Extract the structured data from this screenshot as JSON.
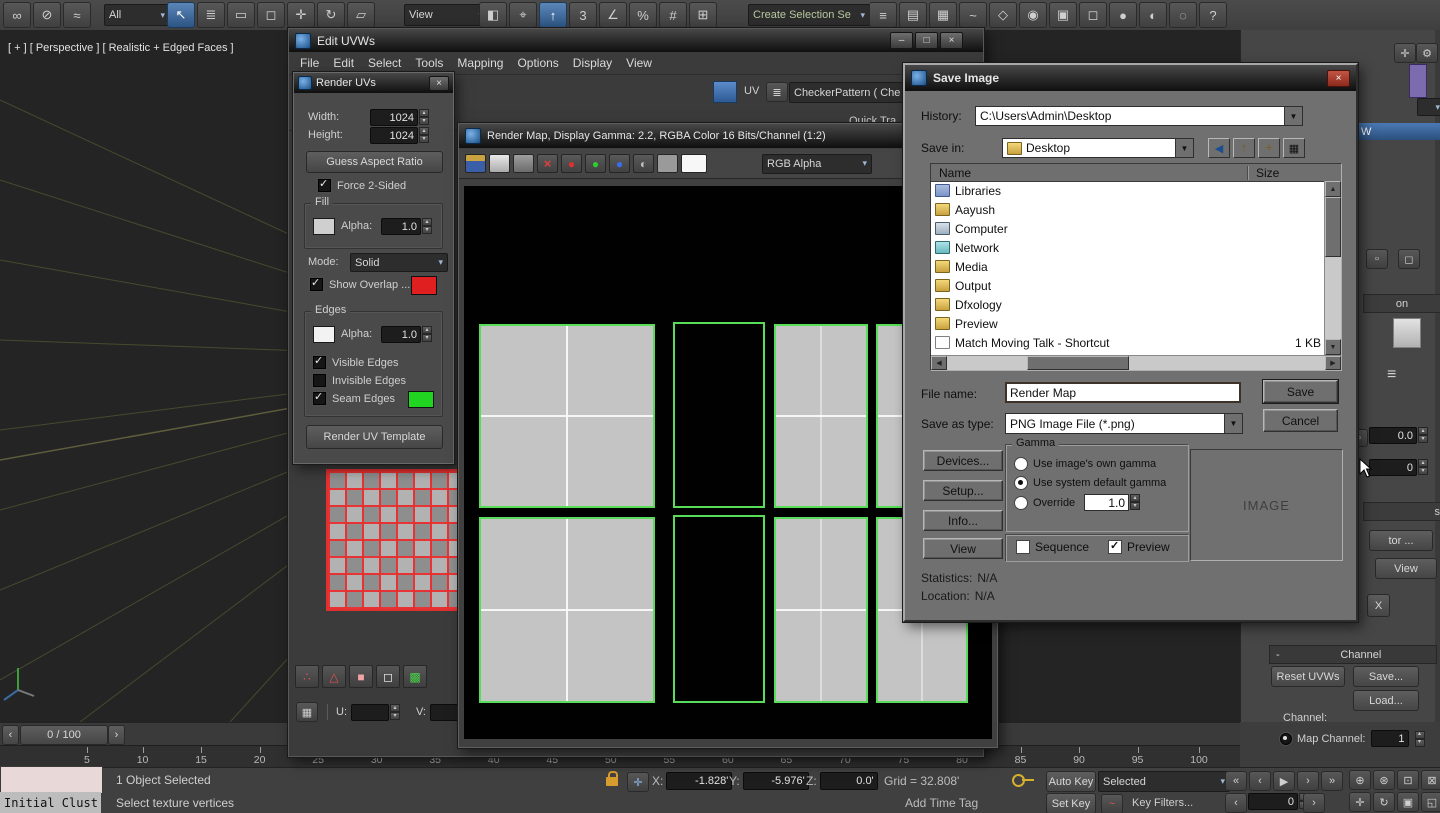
{
  "glyphs": {
    "close": "×",
    "minimize": "–",
    "maximize": "□"
  },
  "viewport": {
    "label": "[ + ] [ Perspective ] [ Realistic + Edged Faces ]"
  },
  "main_toolbar": {
    "all_dropdown": "All",
    "view_dropdown": "View",
    "create_selection_dropdown": "Create Selection Se",
    "icons_g1": [
      {
        "name": "select-and-link-icon",
        "glyph": "∞"
      },
      {
        "name": "unlink-selection-icon",
        "glyph": "⊘"
      },
      {
        "name": "bind-to-space-warp-icon",
        "glyph": "≈"
      }
    ],
    "icons_g2": [
      {
        "name": "select-object-icon",
        "glyph": "↖",
        "cls": "active"
      },
      {
        "name": "select-by-name-icon",
        "glyph": "≣"
      },
      {
        "name": "rectangular-selection-region-icon",
        "glyph": "▭"
      },
      {
        "name": "window-crossing-toggle-icon",
        "glyph": "◻"
      },
      {
        "name": "select-and-move-icon",
        "glyph": "✛"
      },
      {
        "name": "select-and-rotate-icon",
        "glyph": "↻"
      },
      {
        "name": "select-and-scale-icon",
        "glyph": "▱"
      }
    ],
    "icons_g3": [
      {
        "name": "mirror-icon",
        "glyph": "◧"
      },
      {
        "name": "select-and-manipulate-icon",
        "glyph": "⌖"
      },
      {
        "name": "keyboard-shortcut-override-icon",
        "glyph": "↑",
        "cls": "active"
      },
      {
        "name": "snaps-toggle-icon",
        "glyph": "3"
      },
      {
        "name": "angle-snap-icon",
        "glyph": "∠"
      },
      {
        "name": "percent-snap-icon",
        "glyph": "%"
      },
      {
        "name": "spinner-snap-icon",
        "glyph": "#"
      },
      {
        "name": "edit-named-selection-icon",
        "glyph": "⊞"
      }
    ],
    "icons_g4": [
      {
        "name": "align-icon",
        "glyph": "≡"
      },
      {
        "name": "layer-explorer-icon",
        "glyph": "▤"
      },
      {
        "name": "ribbon-icon",
        "glyph": "▦"
      },
      {
        "name": "curve-editor-icon",
        "glyph": "~"
      },
      {
        "name": "schematic-view-icon",
        "glyph": "◇"
      },
      {
        "name": "material-editor-icon",
        "glyph": "◉"
      },
      {
        "name": "render-setup-icon",
        "glyph": "▣"
      },
      {
        "name": "rendered-frame-icon",
        "glyph": "◻"
      },
      {
        "name": "render-production-icon",
        "glyph": "●"
      },
      {
        "name": "lighting-analysis-icon",
        "glyph": "◐"
      },
      {
        "name": "isolate-icon",
        "glyph": "◌"
      },
      {
        "name": "help-icon",
        "glyph": "?"
      }
    ]
  },
  "edit_uvws": {
    "title": "Edit UVWs",
    "menus": [
      "File",
      "Edit",
      "Select",
      "Tools",
      "Mapping",
      "Options",
      "Display",
      "View"
    ],
    "uv_label": "UV",
    "pattern_dropdown": "CheckerPattern  ( Che",
    "quick_transform": "Quick Tra...",
    "u_label": "U:",
    "v_label": "V:",
    "bottom_icons": [
      {
        "name": "soft-selection-icon",
        "glyph": "∴",
        "cls": "red"
      },
      {
        "name": "falloff-icon",
        "glyph": "△",
        "cls": "red"
      },
      {
        "name": "paint-select-icon",
        "glyph": "■",
        "cls": "pink"
      },
      {
        "name": "cube-map-icon",
        "glyph": "◻",
        "cls": "white"
      },
      {
        "name": "grid-options-icon",
        "glyph": "▩",
        "cls": "green"
      }
    ]
  },
  "render_uvs": {
    "title": "Render UVs",
    "width_label": "Width:",
    "width_value": "1024",
    "height_label": "Height:",
    "height_value": "1024",
    "guess_button": "Guess Aspect Ratio",
    "force_label": "Force 2-Sided",
    "fill_group": "Fill",
    "alpha_label": "Alpha:",
    "fill_alpha": "1.0",
    "mode_label": "Mode:",
    "mode_value": "Solid",
    "overlap_label": "Show Overlap ...",
    "edges_group": "Edges",
    "edges_alpha": "1.0",
    "visible_label": "Visible Edges",
    "invisible_label": "Invisible Edges",
    "seam_label": "Seam Edges",
    "render_button": "Render UV Template"
  },
  "render_map": {
    "title": "Render Map, Display Gamma: 2.2, RGBA Color 16 Bits/Channel (1:2)",
    "channel_dropdown": "RGB Alpha",
    "icons": [
      {
        "name": "save-image-icon",
        "glyph": "",
        "cls": "ic-save"
      },
      {
        "name": "clone-image-icon",
        "glyph": "",
        "cls": "ic-clone"
      },
      {
        "name": "print-image-icon",
        "glyph": "",
        "cls": "ic-print"
      },
      {
        "name": "delete-image-icon",
        "glyph": "×",
        "cls": "ic-del"
      },
      {
        "name": "red-channel-icon",
        "glyph": "●",
        "cls": "ic-red"
      },
      {
        "name": "green-channel-icon",
        "glyph": "●",
        "cls": "ic-green"
      },
      {
        "name": "blue-channel-icon",
        "glyph": "●",
        "cls": "ic-blue"
      },
      {
        "name": "monochrome-channel-icon",
        "glyph": "◐",
        "cls": "ic-mono"
      },
      {
        "name": "alpha-channel-icon",
        "glyph": "",
        "cls": "ic-alpha"
      },
      {
        "name": "background-color-swatch",
        "glyph": "",
        "cls": "ic-white"
      }
    ]
  },
  "save_image": {
    "title": "Save Image",
    "history_label": "History:",
    "history_value": "C:\\Users\\Admin\\Desktop",
    "save_in_label": "Save in:",
    "save_in_value": "Desktop",
    "toolbar_icons": [
      {
        "name": "go-back-icon",
        "glyph": "◀",
        "cls": "blueic"
      },
      {
        "name": "up-one-level-icon",
        "glyph": "↑",
        "cls": "yellowic"
      },
      {
        "name": "new-folder-icon",
        "glyph": "+",
        "cls": "yellowic"
      },
      {
        "name": "view-menu-icon",
        "glyph": "▦"
      }
    ],
    "name_column": "Name",
    "size_column": "Size",
    "files": [
      {
        "name": "Libraries",
        "size": "",
        "icon": "library"
      },
      {
        "name": "Aayush",
        "size": "",
        "icon": "user-folder"
      },
      {
        "name": "Computer",
        "size": "",
        "icon": "computer"
      },
      {
        "name": "Network",
        "size": "",
        "icon": "network"
      },
      {
        "name": "Media",
        "size": "",
        "icon": "folder"
      },
      {
        "name": "Output",
        "size": "",
        "icon": "folder"
      },
      {
        "name": "Dfxology",
        "size": "",
        "icon": "folder"
      },
      {
        "name": "Preview",
        "size": "",
        "icon": "folder"
      },
      {
        "name": "Match Moving Talk - Shortcut",
        "size": "1 KB",
        "icon": "shortcut"
      }
    ],
    "file_name_label": "File name:",
    "file_name_value": "Render Map",
    "save_as_type_label": "Save as type:",
    "save_as_type_value": "PNG Image File (*.png)",
    "save_button": "Save",
    "cancel_button": "Cancel",
    "devices_button": "Devices...",
    "setup_button": "Setup...",
    "info_button": "Info...",
    "view_button": "View",
    "gamma_group": "Gamma",
    "gamma_own": "Use image's own gamma",
    "gamma_system": "Use system default gamma",
    "gamma_override": "Override",
    "override_value": "1.0",
    "sequence_label": "Sequence",
    "preview_label": "Preview",
    "image_placeholder": "IMAGE",
    "statistics_label": "Statistics:",
    "statistics_value": "N/A",
    "location_label": "Location:",
    "location_value": "N/A"
  },
  "right_panel": {
    "w_fragment": "W",
    "on_fragment": "on",
    "s_fragment": "s",
    "tor_button": "tor ...",
    "view_button": "View",
    "x_button": "X",
    "value1": "0.0",
    "value2": "0",
    "collapse": "-",
    "channel_section": "Channel",
    "reset_button": "Reset UVWs",
    "save_button": "Save...",
    "load_button": "Load...",
    "channel_label": "Channel:",
    "map_channel_label": "Map Channel:",
    "map_channel_value": "1"
  },
  "timeline": {
    "range_label": "0 / 100",
    "ticks": [
      "5",
      "10",
      "15",
      "20",
      "25",
      "30",
      "35",
      "40",
      "45",
      "50",
      "55",
      "60",
      "65",
      "70",
      "75",
      "80",
      "85",
      "90",
      "95",
      "100"
    ]
  },
  "status_bar": {
    "selection": "1 Object Selected",
    "prompt": "Select texture vertices",
    "x_label": "X:",
    "x_value": "-1.828'",
    "y_label": "Y:",
    "y_value": "-5.976'",
    "z_label": "Z:",
    "z_value": "0.0'",
    "grid_label": "Grid = 32.808'",
    "add_time_tag": "Add Time Tag",
    "auto_key": "Auto Key",
    "set_key": "Set Key",
    "selected_dropdown": "Selected",
    "key_filters": "Key Filters...",
    "frame_value": "0",
    "initial_cluster": "Initial Clust",
    "playback": [
      {
        "name": "go-to-start-icon",
        "glyph": "«"
      },
      {
        "name": "previous-frame-icon",
        "glyph": "‹"
      },
      {
        "name": "play-icon",
        "glyph": "▶"
      },
      {
        "name": "next-frame-icon",
        "glyph": "›"
      },
      {
        "name": "go-to-end-icon",
        "glyph": "»"
      }
    ],
    "nav_row1": [
      {
        "name": "zoom-icon",
        "glyph": "⊕"
      },
      {
        "name": "zoom-all-icon",
        "glyph": "⊛"
      },
      {
        "name": "zoom-extents-icon",
        "glyph": "⊡"
      },
      {
        "name": "zoom-region-icon",
        "glyph": "⊠"
      }
    ],
    "nav_row2": [
      {
        "name": "pan-icon",
        "glyph": "✛"
      },
      {
        "name": "orbit-icon",
        "glyph": "↻"
      },
      {
        "name": "maximize-viewport-icon",
        "glyph": "▣"
      },
      {
        "name": "field-of-view-icon",
        "glyph": "◱"
      }
    ]
  }
}
